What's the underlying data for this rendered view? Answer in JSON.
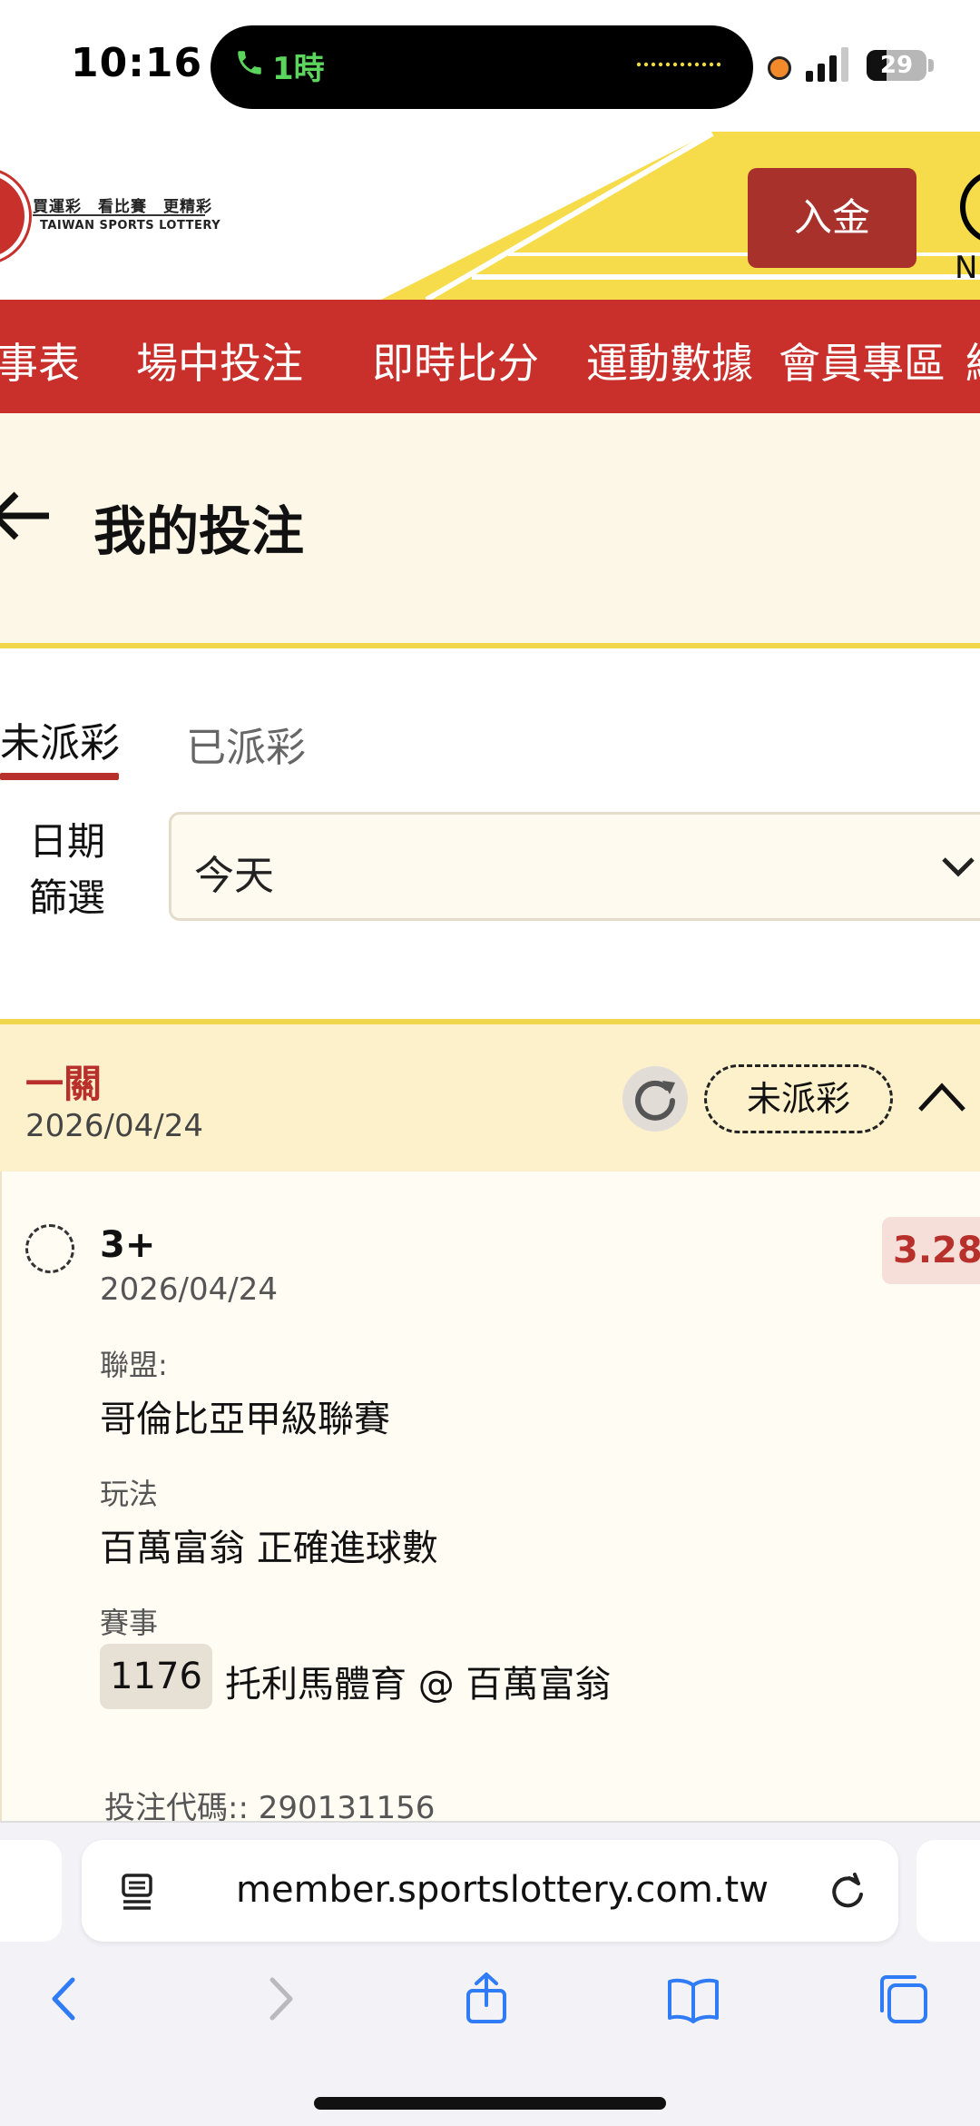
{
  "status_bar": {
    "time": "10:16",
    "call_label": "1時",
    "battery": "29"
  },
  "header": {
    "logo_cn": "買運彩　看比賽　更精彩",
    "logo_en": "TAIWAN SPORTS LOTTERY",
    "deposit_label": "入金",
    "right_partial": "N"
  },
  "nav": {
    "items": [
      "事表",
      "場中投注",
      "即時比分",
      "運動數據",
      "會員專區",
      "統"
    ]
  },
  "page": {
    "title": "我的投注"
  },
  "tabs": [
    {
      "label": "未派彩",
      "active": true
    },
    {
      "label": "已派彩",
      "active": false
    }
  ],
  "filter": {
    "label": "日期篩選",
    "label_line1": "日期",
    "label_line2": "篩選",
    "value": "今天"
  },
  "bet_card": {
    "type": "一關",
    "date": "2026/04/24",
    "status": "未派彩",
    "selection": {
      "name": "3+",
      "date": "2026/04/24",
      "odds": "3.28",
      "league_label": "聯盟:",
      "league": "哥倫比亞甲級聯賽",
      "market_label": "玩法",
      "market": "百萬富翁 正確進球數",
      "event_label": "賽事",
      "event_code": "1176",
      "event": "托利馬體育 @ 百萬富翁"
    },
    "bet_code": "投注代碼:: 290131156"
  },
  "browser": {
    "url": "member.sportslottery.com.tw"
  },
  "colors": {
    "brand_red": "#c9302c",
    "accent_yellow": "#f0d64b",
    "card_header": "#fdf1cc"
  }
}
